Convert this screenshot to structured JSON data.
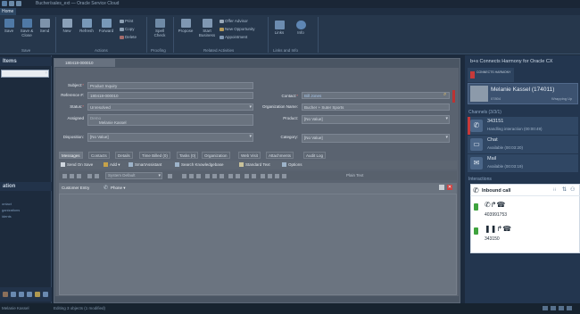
{
  "window": {
    "title": "Bucher/sales_ext — Oracle Service Cloud"
  },
  "ribbon": {
    "home_tab": "Home",
    "groups": [
      {
        "label": "Save",
        "buttons": [
          "Save",
          "Save & Close",
          "Send"
        ]
      },
      {
        "label": "Actions",
        "buttons": [
          "New",
          "Refresh",
          "Forward"
        ],
        "small": [
          "Print",
          "Copy",
          "Delete"
        ]
      },
      {
        "label": "Proofing",
        "buttons": [
          "Spell Check"
        ]
      },
      {
        "label": "Related Activities",
        "buttons": [
          "Propose",
          "Start Business"
        ],
        "small": [
          "Offer Advisor",
          "New Opportunity",
          "Appointment"
        ]
      },
      {
        "label": "Links and Info",
        "buttons": [
          "Links",
          "Info"
        ]
      }
    ]
  },
  "left_panel": {
    "heading": "Items",
    "heading2": "ation",
    "links": [
      "ontact",
      "ganizations",
      "idents"
    ]
  },
  "form": {
    "tab_label": "180418-000010",
    "fields": {
      "subject_label": "Subject:",
      "subject_value": "Product Inquiry",
      "reference_label": "Reference #:",
      "reference_value": "180418-000010",
      "status_label": "Status:",
      "status_value": "Unresolved",
      "assigned_label": "Assigned",
      "assigned_group": "Demo",
      "assigned_value": "Melanie Kassel",
      "disposition_label": "Disposition:",
      "disposition_value": "[No Value]",
      "contact_label": "Contact:",
      "contact_value": "Bill Jones",
      "org_label": "Organization Name:",
      "org_value": "Bucher + Suter Sports",
      "product_label": "Product:",
      "product_value": "[No Value]",
      "category_label": "Category:",
      "category_value": "[No Value]"
    },
    "subtabs": [
      "Messages",
      "Contacts",
      "Details",
      "Time Billed (0)",
      "Tasks (0)",
      "Organization",
      "Web Visit",
      "Attachments",
      "Audit Log"
    ],
    "message_toolbar": {
      "send_on_save": "Send On Save",
      "add": "Add",
      "smart_assistant": "SmartAssistant",
      "search_kb": "Search Knowledgebase",
      "standard_text": "Standard Text",
      "options": "Options"
    },
    "format_bar": {
      "font": "System Default",
      "plain_text": "Plain Text"
    },
    "editor_header": {
      "entry_type": "Customer Entry",
      "channel": "Phone"
    }
  },
  "right_panel": {
    "title": "b+s Connects Harmony for Oracle CX",
    "logo_text": "CONNECTS HARMONY",
    "agent": {
      "name": "Melanie Kassel (174011)",
      "extension": "07804",
      "state": "Wrapping Up"
    },
    "channels_heading": "Channels (3/3/1)",
    "channels": [
      {
        "name": "343151",
        "status": "Handling interaction (00:00:49)"
      },
      {
        "name": "Chat",
        "status": "Available (00:03:20)"
      },
      {
        "name": "Mail",
        "status": "Available (00:03:19)"
      }
    ],
    "interactions_heading": "Interactions",
    "interactions": {
      "title": "Inbound call",
      "calls": [
        {
          "number": "403991753"
        },
        {
          "number": "343150"
        }
      ]
    }
  },
  "statusbar": {
    "user": "Melanie Kassel",
    "message": "Editing 3 objects (1 modified)"
  }
}
